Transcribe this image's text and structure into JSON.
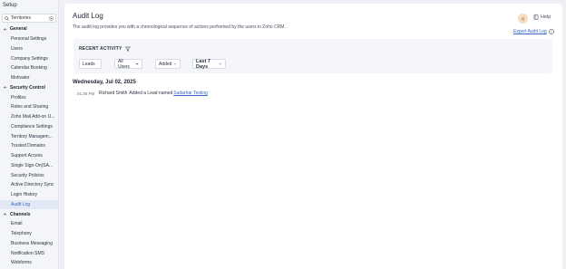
{
  "sidebar": {
    "title": "Setup",
    "search": {
      "value": "Territories"
    },
    "sections": [
      {
        "label": "General",
        "items": [
          "Personal Settings",
          "Users",
          "Company Settings",
          "Calendar Booking",
          "Motivator"
        ]
      },
      {
        "label": "Security Control",
        "items": [
          "Profiles",
          "Roles and Sharing",
          "Zoho Mail Add-on U...",
          "Compliance Settings",
          "Territory Managem...",
          "Trusted Domains",
          "Support Access",
          "Single Sign-On(SA...",
          "Security Policies",
          "Active Directory Sync",
          "Login History",
          "Audit Log"
        ]
      },
      {
        "label": "Channels",
        "items": [
          "Email",
          "Telephony",
          "Business Messaging",
          "Notification SMS",
          "Webforms"
        ]
      }
    ],
    "active_item": "Audit Log"
  },
  "header": {
    "title": "Audit Log",
    "description": "The audit log provides you with a chronological sequence of actions performed by the users in Zoho CRM.",
    "avatar_initials": "sj",
    "help_label": "Help",
    "export_label": "Export Audit Log"
  },
  "filters": {
    "heading": "RECENT ACTIVITY",
    "module": "Leads",
    "users": "All Users",
    "action": "Added",
    "period": "Last 7 Days"
  },
  "log": {
    "date": "Wednesday, Jul 02, 2025",
    "entries": [
      {
        "time": "01:35 PM",
        "user": "Richard Smith",
        "action": "Added a Lead named",
        "target": "Sudarhar Testing"
      }
    ]
  },
  "colors": {
    "accent": "#3566c8",
    "active_bg": "#e2e8f5",
    "avatar_bg": "#f6dcc0"
  }
}
